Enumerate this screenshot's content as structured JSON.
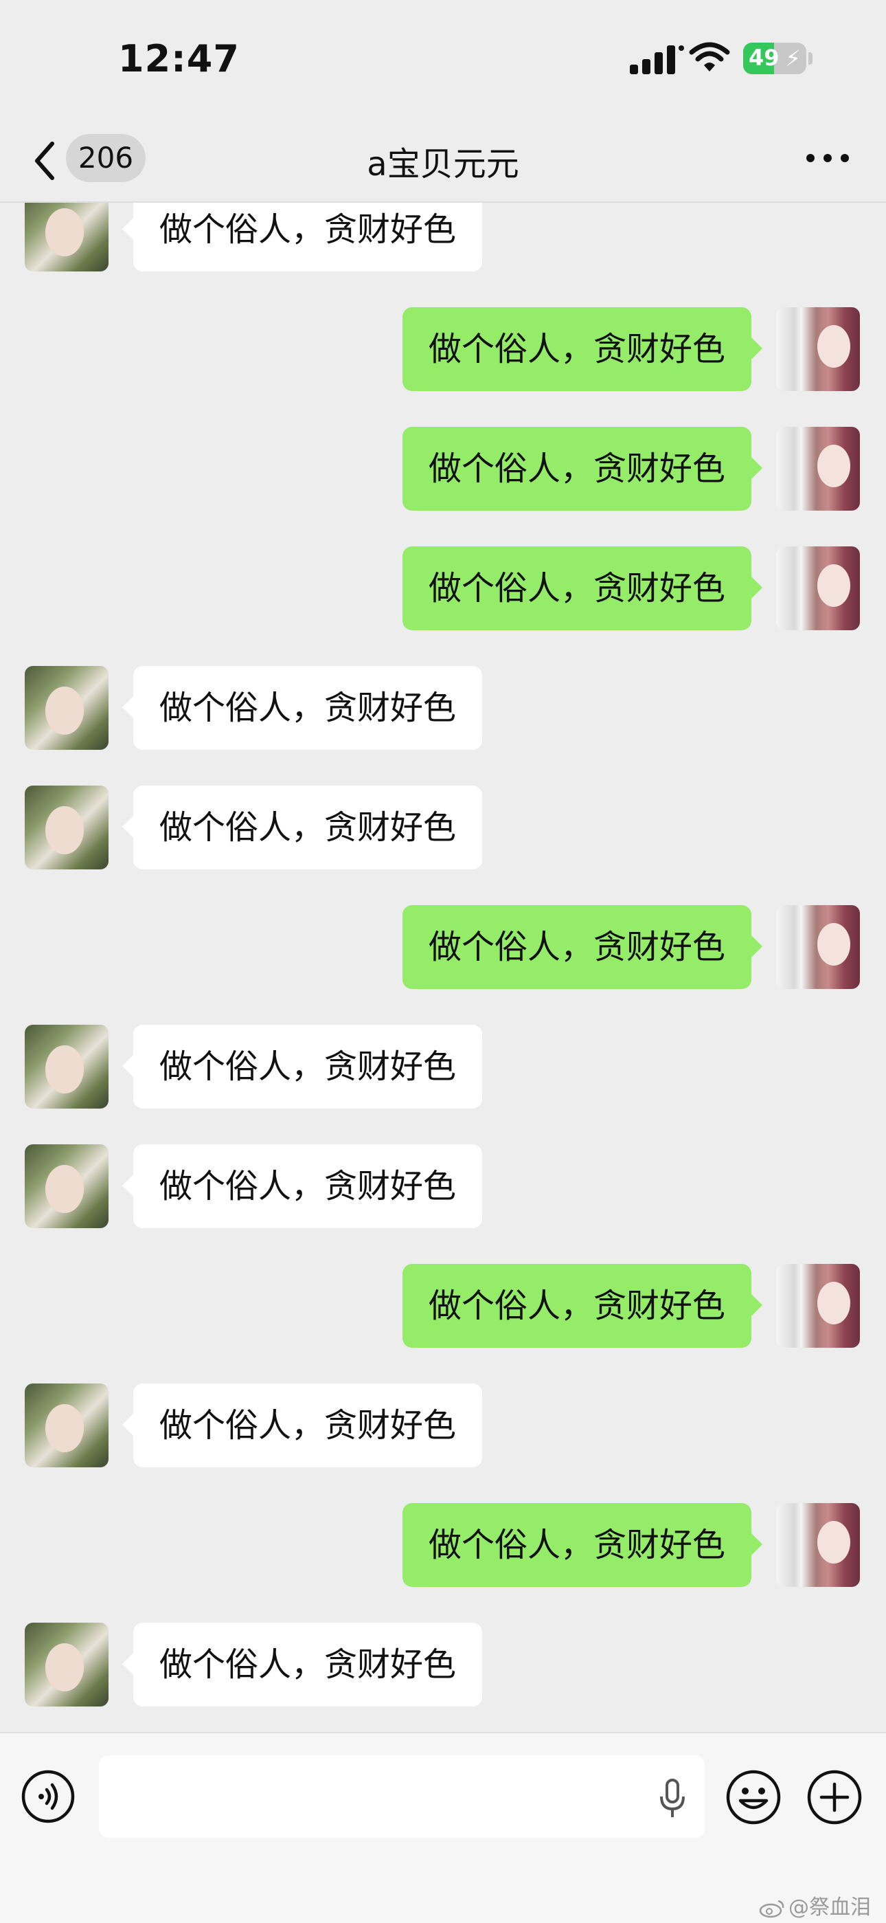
{
  "status_bar": {
    "time": "12:47",
    "battery_percent": "49",
    "battery_level": 0.49,
    "charging": true,
    "icons": [
      "cellular-signal-icon",
      "wifi-icon",
      "battery-charging-icon"
    ]
  },
  "nav": {
    "unread_count": "206",
    "title": "a宝贝元元",
    "icons": [
      "back-chevron-icon",
      "more-dots-icon"
    ]
  },
  "messages": [
    {
      "sender": "friend",
      "text": "做个俗人，贪财好色"
    },
    {
      "sender": "me",
      "text": "做个俗人，贪财好色"
    },
    {
      "sender": "me",
      "text": "做个俗人，贪财好色"
    },
    {
      "sender": "me",
      "text": "做个俗人，贪财好色"
    },
    {
      "sender": "friend",
      "text": "做个俗人，贪财好色"
    },
    {
      "sender": "friend",
      "text": "做个俗人，贪财好色"
    },
    {
      "sender": "me",
      "text": "做个俗人，贪财好色"
    },
    {
      "sender": "friend",
      "text": "做个俗人，贪财好色"
    },
    {
      "sender": "friend",
      "text": "做个俗人，贪财好色"
    },
    {
      "sender": "me",
      "text": "做个俗人，贪财好色"
    },
    {
      "sender": "friend",
      "text": "做个俗人，贪财好色"
    },
    {
      "sender": "me",
      "text": "做个俗人，贪财好色"
    },
    {
      "sender": "friend",
      "text": "做个俗人，贪财好色"
    }
  ],
  "input_bar": {
    "placeholder": "",
    "icons": [
      "voice-mode-icon",
      "microphone-icon",
      "emoji-icon",
      "plus-icon"
    ]
  },
  "watermark": "@祭血泪",
  "colors": {
    "background": "#ededed",
    "my_bubble": "#95ec69",
    "friend_bubble": "#ffffff",
    "battery_fill": "#34c759"
  }
}
